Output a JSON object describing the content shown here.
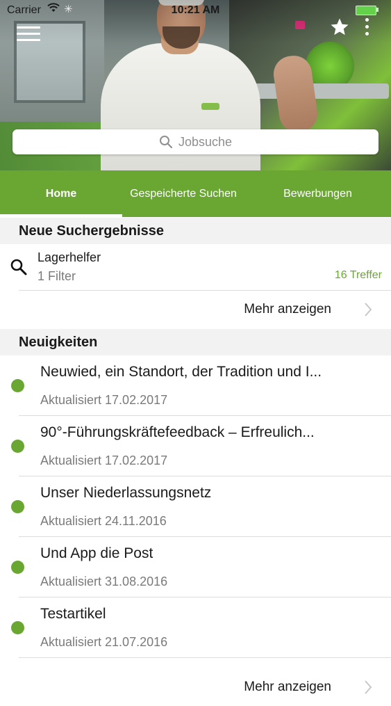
{
  "status_bar": {
    "carrier": "Carrier",
    "time": "10:21 AM",
    "battery_color": "#63d24a"
  },
  "header": {
    "menu_icon": "hamburger-menu-icon",
    "favorite_icon": "star-icon",
    "more_icon": "vertical-dots-icon",
    "search_placeholder": "Jobsuche"
  },
  "tabs": [
    {
      "label": "Home",
      "active": true
    },
    {
      "label": "Gespeicherte Suchen",
      "active": false
    },
    {
      "label": "Bewerbungen",
      "active": false
    }
  ],
  "colors": {
    "accent": "#6aa632",
    "section_bg": "#f2f2f2"
  },
  "new_results": {
    "title": "Neue Suchergebnisse",
    "item": {
      "title": "Lagerhelfer",
      "filters": "1 Filter",
      "count": "16 Treffer"
    },
    "more_label": "Mehr anzeigen"
  },
  "news": {
    "title": "Neuigkeiten",
    "items": [
      {
        "title": "Neuwied, ein Standort, der Tradition und I...",
        "date": "Aktualisiert 17.02.2017"
      },
      {
        "title": "90°-Führungskräftefeedback – Erfreulich...",
        "date": "Aktualisiert 17.02.2017"
      },
      {
        "title": "Unser Niederlassungsnetz",
        "date": "Aktualisiert 24.11.2016"
      },
      {
        "title": "Und App die Post",
        "date": "Aktualisiert 31.08.2016"
      },
      {
        "title": "Testartikel",
        "date": "Aktualisiert 21.07.2016"
      }
    ],
    "more_label": "Mehr anzeigen"
  }
}
